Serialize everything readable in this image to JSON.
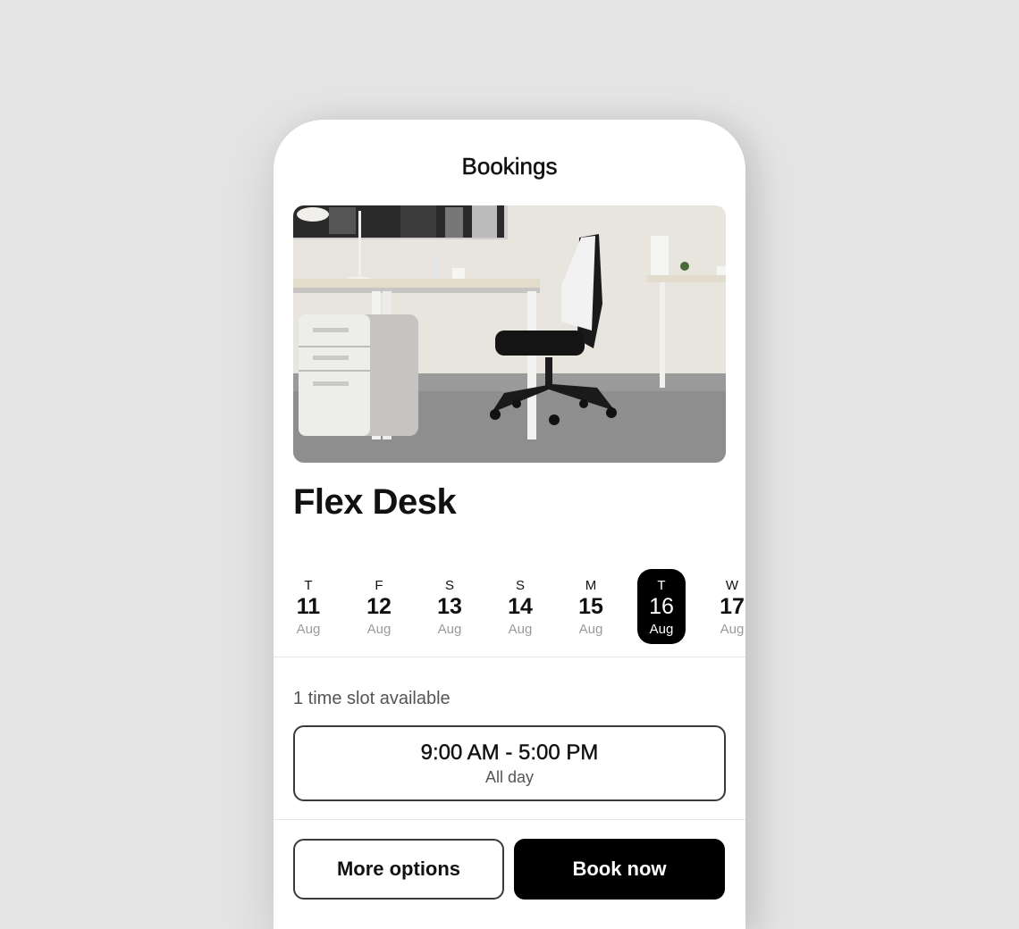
{
  "header": {
    "title": "Bookings"
  },
  "space": {
    "name": "Flex Desk",
    "image_alt": "Office desk with black chair and white filing cabinet"
  },
  "dates": [
    {
      "dow": "T",
      "day": "11",
      "month": "Aug",
      "selected": false
    },
    {
      "dow": "F",
      "day": "12",
      "month": "Aug",
      "selected": false
    },
    {
      "dow": "S",
      "day": "13",
      "month": "Aug",
      "selected": false
    },
    {
      "dow": "S",
      "day": "14",
      "month": "Aug",
      "selected": false
    },
    {
      "dow": "M",
      "day": "15",
      "month": "Aug",
      "selected": false
    },
    {
      "dow": "T",
      "day": "16",
      "month": "Aug",
      "selected": true
    },
    {
      "dow": "W",
      "day": "17",
      "month": "Aug",
      "selected": false
    }
  ],
  "availability": {
    "count_label": "1 time slot available",
    "slots": [
      {
        "time": "9:00 AM - 5:00 PM",
        "label": "All day"
      }
    ]
  },
  "actions": {
    "more_options_label": "More options",
    "book_now_label": "Book now"
  },
  "colors": {
    "background": "#e4e4e4",
    "card": "#ffffff",
    "accent": "#000000",
    "muted_text": "#9a9a9a"
  }
}
